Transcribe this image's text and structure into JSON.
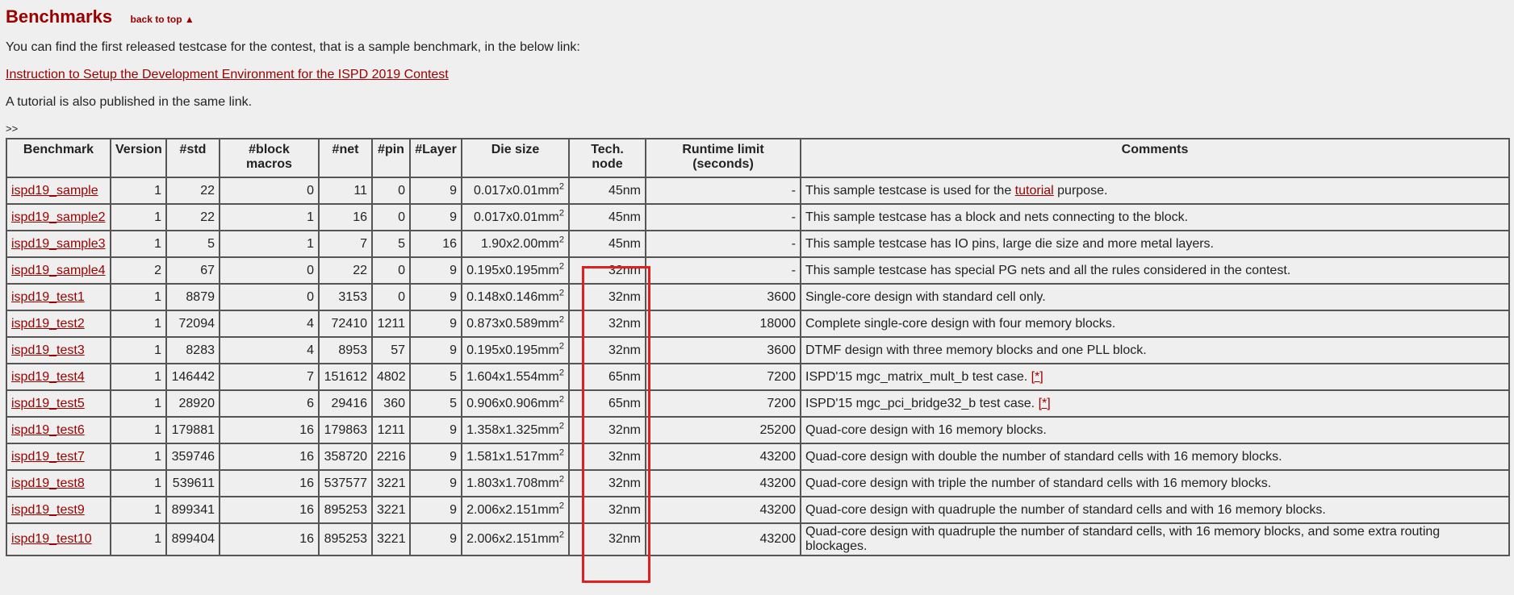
{
  "section": {
    "title": "Benchmarks",
    "back_to_top": "back to top ▲"
  },
  "intro": {
    "line1": "You can find the first released testcase for the contest, that is a sample benchmark, in the below link:",
    "link_text": "Instruction to Setup the Development Environment for the ISPD 2019 Contest",
    "line2": "A tutorial is also published in the same link.",
    "marker": ">>"
  },
  "table": {
    "headers": {
      "benchmark": "Benchmark",
      "version": "Version",
      "std": "#std",
      "block_macros": "#block macros",
      "net": "#net",
      "pin": "#pin",
      "layer": "#Layer",
      "die_size": "Die size",
      "tech_node": "Tech. node",
      "runtime_limit": "Runtime limit (seconds)",
      "comments": "Comments"
    },
    "die_unit": "mm",
    "die_unit_sup": "2",
    "rows": [
      {
        "name": "ispd19_sample",
        "version": "1",
        "std": "22",
        "block": "0",
        "net": "11",
        "pin": "0",
        "layer": "9",
        "die": "0.017x0.01",
        "tech": "45nm",
        "runtime": "-",
        "comment_pre": "This sample testcase is used for the ",
        "comment_link": "tutorial",
        "comment_post": " purpose."
      },
      {
        "name": "ispd19_sample2",
        "version": "1",
        "std": "22",
        "block": "1",
        "net": "16",
        "pin": "0",
        "layer": "9",
        "die": "0.017x0.01",
        "tech": "45nm",
        "runtime": "-",
        "comment_pre": "This sample testcase has a block and nets connecting to the block.",
        "comment_link": "",
        "comment_post": ""
      },
      {
        "name": "ispd19_sample3",
        "version": "1",
        "std": "5",
        "block": "1",
        "net": "7",
        "pin": "5",
        "layer": "16",
        "die": "1.90x2.00",
        "tech": "45nm",
        "runtime": "-",
        "comment_pre": "This sample testcase has IO pins, large die size and more metal layers.",
        "comment_link": "",
        "comment_post": ""
      },
      {
        "name": "ispd19_sample4",
        "version": "2",
        "std": "67",
        "block": "0",
        "net": "22",
        "pin": "0",
        "layer": "9",
        "die": "0.195x0.195",
        "tech": "32nm",
        "runtime": "-",
        "comment_pre": "This sample testcase has special PG nets and all the rules considered in the contest.",
        "comment_link": "",
        "comment_post": ""
      },
      {
        "name": "ispd19_test1",
        "version": "1",
        "std": "8879",
        "block": "0",
        "net": "3153",
        "pin": "0",
        "layer": "9",
        "die": "0.148x0.146",
        "tech": "32nm",
        "runtime": "3600",
        "comment_pre": "Single-core design with standard cell only.",
        "comment_link": "",
        "comment_post": ""
      },
      {
        "name": "ispd19_test2",
        "version": "1",
        "std": "72094",
        "block": "4",
        "net": "72410",
        "pin": "1211",
        "layer": "9",
        "die": "0.873x0.589",
        "tech": "32nm",
        "runtime": "18000",
        "comment_pre": "Complete single-core design with four memory blocks.",
        "comment_link": "",
        "comment_post": ""
      },
      {
        "name": "ispd19_test3",
        "version": "1",
        "std": "8283",
        "block": "4",
        "net": "8953",
        "pin": "57",
        "layer": "9",
        "die": "0.195x0.195",
        "tech": "32nm",
        "runtime": "3600",
        "comment_pre": "DTMF design with three memory blocks and one PLL block.",
        "comment_link": "",
        "comment_post": ""
      },
      {
        "name": "ispd19_test4",
        "version": "1",
        "std": "146442",
        "block": "7",
        "net": "151612",
        "pin": "4802",
        "layer": "5",
        "die": "1.604x1.554",
        "tech": "65nm",
        "runtime": "7200",
        "comment_pre": "ISPD'15 mgc_matrix_mult_b test case. ",
        "comment_link": "[*]",
        "comment_post": ""
      },
      {
        "name": "ispd19_test5",
        "version": "1",
        "std": "28920",
        "block": "6",
        "net": "29416",
        "pin": "360",
        "layer": "5",
        "die": "0.906x0.906",
        "tech": "65nm",
        "runtime": "7200",
        "comment_pre": "ISPD'15 mgc_pci_bridge32_b test case. ",
        "comment_link": "[*]",
        "comment_post": ""
      },
      {
        "name": "ispd19_test6",
        "version": "1",
        "std": "179881",
        "block": "16",
        "net": "179863",
        "pin": "1211",
        "layer": "9",
        "die": "1.358x1.325",
        "tech": "32nm",
        "runtime": "25200",
        "comment_pre": "Quad-core design with 16 memory blocks.",
        "comment_link": "",
        "comment_post": ""
      },
      {
        "name": "ispd19_test7",
        "version": "1",
        "std": "359746",
        "block": "16",
        "net": "358720",
        "pin": "2216",
        "layer": "9",
        "die": "1.581x1.517",
        "tech": "32nm",
        "runtime": "43200",
        "comment_pre": "Quad-core design with double the number of standard cells with 16 memory blocks.",
        "comment_link": "",
        "comment_post": ""
      },
      {
        "name": "ispd19_test8",
        "version": "1",
        "std": "539611",
        "block": "16",
        "net": "537577",
        "pin": "3221",
        "layer": "9",
        "die": "1.803x1.708",
        "tech": "32nm",
        "runtime": "43200",
        "comment_pre": "Quad-core design with triple the number of standard cells with 16 memory blocks.",
        "comment_link": "",
        "comment_post": ""
      },
      {
        "name": "ispd19_test9",
        "version": "1",
        "std": "899341",
        "block": "16",
        "net": "895253",
        "pin": "3221",
        "layer": "9",
        "die": "2.006x2.151",
        "tech": "32nm",
        "runtime": "43200",
        "comment_pre": "Quad-core design with quadruple the number of standard cells and with 16 memory blocks.",
        "comment_link": "",
        "comment_post": ""
      },
      {
        "name": "ispd19_test10",
        "version": "1",
        "std": "899404",
        "block": "16",
        "net": "895253",
        "pin": "3221",
        "layer": "9",
        "die": "2.006x2.151",
        "tech": "32nm",
        "runtime": "43200",
        "comment_pre": "Quad-core design with quadruple the number of standard cells, with 16 memory blocks, and some extra routing blockages.",
        "comment_link": "",
        "comment_post": ""
      }
    ]
  },
  "colors": {
    "link": "#990000",
    "highlight_box": "#e02020",
    "background": "#efefef"
  }
}
